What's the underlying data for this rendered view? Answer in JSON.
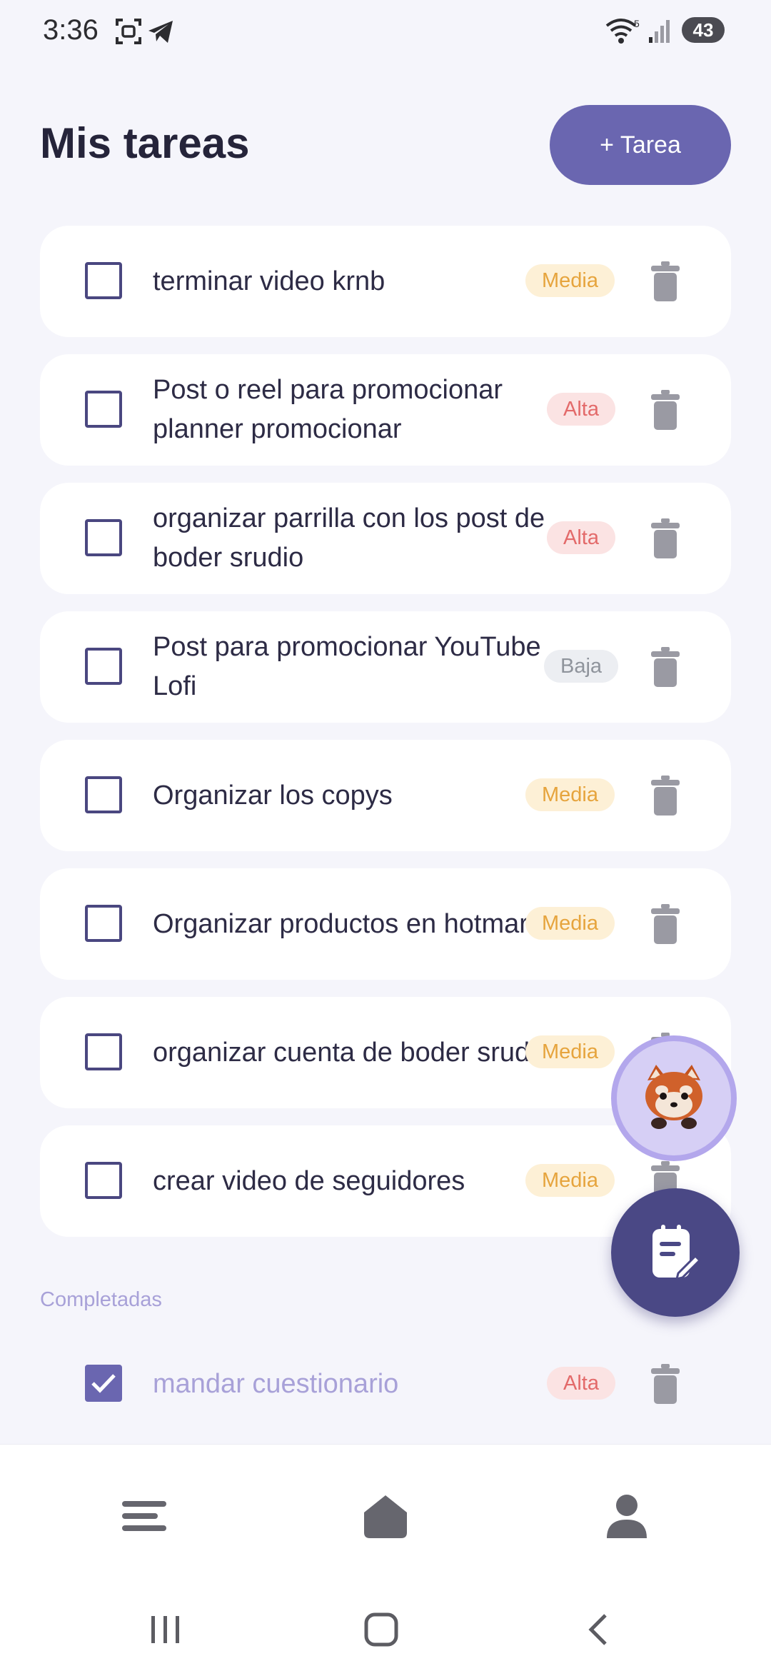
{
  "status_bar": {
    "time": "3:36",
    "battery": "43",
    "icons": [
      "screenshot-icon",
      "telegram-icon",
      "wifi-icon",
      "signal-icon",
      "battery-icon"
    ]
  },
  "header": {
    "title": "Mis tareas",
    "add_button_label": "+ Tarea"
  },
  "tasks": [
    {
      "text": "terminar video krnb",
      "priority": "Media",
      "done": false
    },
    {
      "text": "Post o reel para promocionar planner promocionar",
      "priority": "Alta",
      "done": false
    },
    {
      "text": "organizar parrilla con los post de boder srudio",
      "priority": "Alta",
      "done": false
    },
    {
      "text": "Post para promocionar YouTube Lofi",
      "priority": "Baja",
      "done": false
    },
    {
      "text": "Organizar los copys",
      "priority": "Media",
      "done": false
    },
    {
      "text": "Organizar productos en hotmart",
      "priority": "Media",
      "done": false
    },
    {
      "text": "organizar cuenta de boder srudio",
      "priority": "Media",
      "done": false
    },
    {
      "text": "crear video de seguidores",
      "priority": "Media",
      "done": false
    }
  ],
  "completed_section": {
    "label": "Completadas",
    "items": [
      {
        "text": "mandar cuestionario",
        "priority": "Alta",
        "done": true
      }
    ]
  },
  "colors": {
    "accent": "#6a66b0",
    "fab": "#4a4885",
    "priority_media": "#e6a43d",
    "priority_alta": "#e36a6a",
    "priority_baja": "#8f949c"
  },
  "bottom_nav": [
    "menu-icon",
    "home-icon",
    "profile-icon"
  ],
  "system_nav": [
    "recents-icon",
    "home-button-icon",
    "back-icon"
  ]
}
